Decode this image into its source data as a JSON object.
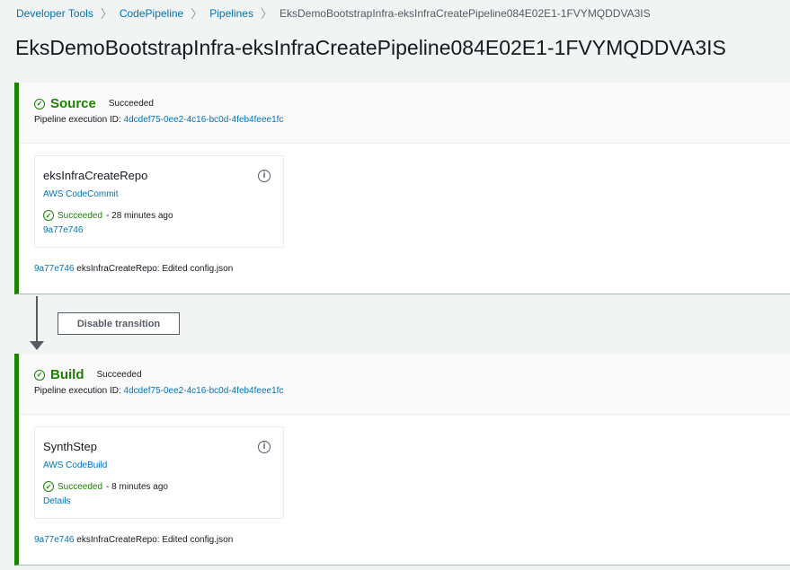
{
  "breadcrumb": [
    "Developer Tools",
    "CodePipeline",
    "Pipelines",
    "EksDemoBootstrapInfra-eksInfraCreatePipeline084E02E1-1FVYMQDDVA3IS"
  ],
  "title": "EksDemoBootstrapInfra-eksInfraCreatePipeline084E02E1-1FVYMQDDVA3IS",
  "exec_label": "Pipeline execution ID:",
  "transition_button": "Disable transition",
  "stages": [
    {
      "name": "Source",
      "status": "Succeeded",
      "execution_id": "4dcdef75-0ee2-4c16-bc0d-4feb4feee1fc",
      "action": {
        "name": "eksInfraCreateRepo",
        "provider": "AWS CodeCommit",
        "status": "Succeeded",
        "time": "- 28 minutes ago",
        "link": "9a77e746"
      },
      "commit": {
        "id": "9a77e746",
        "message": "eksInfraCreateRepo: Edited config.json"
      }
    },
    {
      "name": "Build",
      "status": "Succeeded",
      "execution_id": "4dcdef75-0ee2-4c16-bc0d-4feb4feee1fc",
      "action": {
        "name": "SynthStep",
        "provider": "AWS CodeBuild",
        "status": "Succeeded",
        "time": "- 8 minutes ago",
        "link": "Details"
      },
      "commit": {
        "id": "9a77e746",
        "message": "eksInfraCreateRepo: Edited config.json"
      }
    }
  ]
}
